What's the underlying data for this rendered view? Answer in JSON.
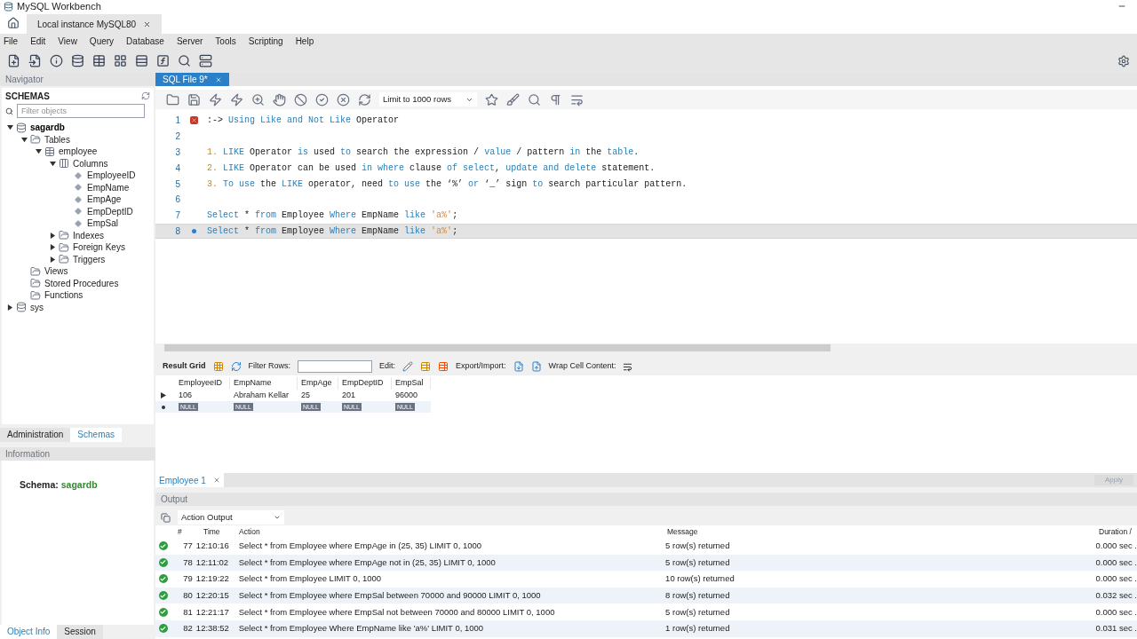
{
  "window": {
    "title": "MySQL Workbench"
  },
  "connection_tabs": [
    {
      "label": "Local instance MySQL80",
      "selected": true
    }
  ],
  "menu": [
    "File",
    "Edit",
    "View",
    "Query",
    "Database",
    "Server",
    "Tools",
    "Scripting",
    "Help"
  ],
  "navigator": {
    "title": "Navigator",
    "section": "SCHEMAS",
    "filter_placeholder": "Filter objects",
    "tree": [
      {
        "label": "sagardb",
        "kind": "database",
        "expanded": true,
        "selected": true,
        "children": [
          {
            "label": "Tables",
            "kind": "folder",
            "expanded": true,
            "selected": false,
            "children": [
              {
                "label": "employee",
                "kind": "table",
                "expanded": true,
                "selected": false,
                "children": [
                  {
                    "label": "Columns",
                    "kind": "columns",
                    "expanded": true,
                    "selected": false,
                    "children": [
                      {
                        "label": "EmployeeID",
                        "kind": "column",
                        "selected": false
                      },
                      {
                        "label": "EmpName",
                        "kind": "column",
                        "selected": false
                      },
                      {
                        "label": "EmpAge",
                        "kind": "column",
                        "selected": false
                      },
                      {
                        "label": "EmpDeptID",
                        "kind": "column",
                        "selected": false
                      },
                      {
                        "label": "EmpSal",
                        "kind": "column",
                        "selected": false
                      }
                    ]
                  },
                  {
                    "label": "Indexes",
                    "kind": "folder",
                    "expanded": false,
                    "selected": false
                  },
                  {
                    "label": "Foreign Keys",
                    "kind": "folder",
                    "expanded": false,
                    "selected": false
                  },
                  {
                    "label": "Triggers",
                    "kind": "folder",
                    "expanded": false,
                    "selected": false
                  }
                ]
              }
            ]
          },
          {
            "label": "Views",
            "kind": "folder",
            "selected": false
          },
          {
            "label": "Stored Procedures",
            "kind": "folder",
            "selected": false
          },
          {
            "label": "Functions",
            "kind": "folder",
            "selected": false
          }
        ]
      },
      {
        "label": "sys",
        "kind": "database",
        "expanded": false,
        "selected": false
      }
    ]
  },
  "side_tabs": [
    {
      "label": "Administration",
      "selected": false
    },
    {
      "label": "Schemas",
      "selected": true
    }
  ],
  "information": {
    "title": "Information",
    "label": "Schema:",
    "value": "sagardb"
  },
  "bottom_tabs": [
    {
      "label": "Object Info",
      "selected": true
    },
    {
      "label": "Session",
      "selected": false
    }
  ],
  "editor": {
    "tab": {
      "label": "SQL File 9*",
      "selected": true
    },
    "limit": "Limit to 1000 rows",
    "lines": [
      {
        "number": "1",
        "error": true,
        "statement": false,
        "current": false,
        "tokens": [
          {
            "text": ":-> ",
            "kind": "plain"
          },
          {
            "text": "Using Like and Not Like",
            "kind": "keyword"
          },
          {
            "text": " Operator",
            "kind": "plain"
          }
        ]
      },
      {
        "number": "2",
        "error": false,
        "statement": false,
        "current": false
      },
      {
        "number": "3",
        "error": false,
        "statement": false,
        "current": false,
        "tokens": [
          {
            "text": "1.",
            "kind": "number"
          },
          {
            "text": " LIKE",
            "kind": "keyword"
          },
          {
            "text": " Operator ",
            "kind": "plain"
          },
          {
            "text": "is",
            "kind": "keyword"
          },
          {
            "text": " used ",
            "kind": "plain"
          },
          {
            "text": "to",
            "kind": "keyword"
          },
          {
            "text": " search the expression / ",
            "kind": "plain"
          },
          {
            "text": "value",
            "kind": "keyword"
          },
          {
            "text": " / pattern ",
            "kind": "plain"
          },
          {
            "text": "in",
            "kind": "keyword"
          },
          {
            "text": " the ",
            "kind": "plain"
          },
          {
            "text": "table",
            "kind": "keyword"
          },
          {
            "text": ".",
            "kind": "plain"
          }
        ]
      },
      {
        "number": "4",
        "error": false,
        "statement": false,
        "current": false,
        "tokens": [
          {
            "text": "2.",
            "kind": "number"
          },
          {
            "text": " LIKE",
            "kind": "keyword"
          },
          {
            "text": " Operator can be used ",
            "kind": "plain"
          },
          {
            "text": "in where",
            "kind": "keyword"
          },
          {
            "text": " clause ",
            "kind": "plain"
          },
          {
            "text": "of select",
            "kind": "keyword"
          },
          {
            "text": ", ",
            "kind": "plain"
          },
          {
            "text": "update and delete",
            "kind": "keyword"
          },
          {
            "text": " statement.",
            "kind": "plain"
          }
        ]
      },
      {
        "number": "5",
        "error": false,
        "statement": false,
        "current": false,
        "tokens": [
          {
            "text": "3.",
            "kind": "number"
          },
          {
            "text": " To use",
            "kind": "keyword"
          },
          {
            "text": " the ",
            "kind": "plain"
          },
          {
            "text": "LIKE",
            "kind": "keyword"
          },
          {
            "text": " operator, need ",
            "kind": "plain"
          },
          {
            "text": "to use",
            "kind": "keyword"
          },
          {
            "text": " the ‘%’ ",
            "kind": "plain"
          },
          {
            "text": "or",
            "kind": "keyword"
          },
          {
            "text": " ‘_’ sign ",
            "kind": "plain"
          },
          {
            "text": "to",
            "kind": "keyword"
          },
          {
            "text": " search particular pattern.",
            "kind": "plain"
          }
        ]
      },
      {
        "number": "6",
        "error": false,
        "statement": false,
        "current": false
      },
      {
        "number": "7",
        "error": false,
        "statement": false,
        "current": false,
        "tokens": [
          {
            "text": "Select",
            "kind": "keyword"
          },
          {
            "text": " * ",
            "kind": "plain"
          },
          {
            "text": "from",
            "kind": "keyword"
          },
          {
            "text": " Employee ",
            "kind": "plain"
          },
          {
            "text": "Where",
            "kind": "keyword"
          },
          {
            "text": " EmpName ",
            "kind": "plain"
          },
          {
            "text": "like",
            "kind": "keyword"
          },
          {
            "text": " 'a%'",
            "kind": "string"
          },
          {
            "text": ";",
            "kind": "plain"
          }
        ]
      },
      {
        "number": "8",
        "error": false,
        "statement": true,
        "current": true,
        "tokens": [
          {
            "text": "Select",
            "kind": "keyword"
          },
          {
            "text": " * ",
            "kind": "plain"
          },
          {
            "text": "from",
            "kind": "keyword"
          },
          {
            "text": " Employee ",
            "kind": "plain"
          },
          {
            "text": "Where",
            "kind": "keyword"
          },
          {
            "text": " EmpName ",
            "kind": "plain"
          },
          {
            "text": "like",
            "kind": "keyword"
          },
          {
            "text": " 'a%'",
            "kind": "string"
          },
          {
            "text": ";",
            "kind": "plain"
          }
        ]
      }
    ]
  },
  "result": {
    "label": "Result Grid",
    "filter_label": "Filter Rows:",
    "edit_label": "Edit:",
    "export_label": "Export/Import:",
    "wrap_label": "Wrap Cell Content:",
    "columns": [
      "EmployeeID",
      "EmpName",
      "EmpAge",
      "EmpDeptID",
      "EmpSal"
    ],
    "rows": [
      {
        "kind": "data",
        "cells": [
          "106",
          "Abraham Kellar",
          "25",
          "201",
          "96000"
        ]
      },
      {
        "kind": "new",
        "cells": [
          "NULL",
          "NULL",
          "NULL",
          "NULL",
          "NULL"
        ]
      }
    ]
  },
  "result_tabs": [
    {
      "label": "Employee 1",
      "selected": true
    }
  ],
  "apply_button": {
    "label": "Apply",
    "disabled": true
  },
  "output": {
    "title": "Output",
    "selector": "Action Output",
    "columns": [
      "#",
      "Time",
      "Action",
      "Message",
      "Duration /"
    ],
    "rows": [
      {
        "success": true,
        "number": "77",
        "time": "12:10:16",
        "action": "Select * from Employee where EmpAge in (25, 35) LIMIT 0, 1000",
        "message": "5 row(s) returned",
        "duration": "0.000 sec ."
      },
      {
        "success": true,
        "number": "78",
        "time": "12:11:02",
        "action": "Select * from Employee where EmpAge not in (25, 35) LIMIT 0, 1000",
        "message": "5 row(s) returned",
        "duration": "0.000 sec ."
      },
      {
        "success": true,
        "number": "79",
        "time": "12:19:22",
        "action": "Select * from Employee LIMIT 0, 1000",
        "message": "10 row(s) returned",
        "duration": "0.000 sec ."
      },
      {
        "success": true,
        "number": "80",
        "time": "12:20:15",
        "action": "Select * from Employee where EmpSal between 70000 and 90000 LIMIT 0, 1000",
        "message": "8 row(s) returned",
        "duration": "0.032 sec ."
      },
      {
        "success": true,
        "number": "81",
        "time": "12:21:17",
        "action": "Select * from Employee where EmpSal not between 70000 and 80000 LIMIT 0, 1000",
        "message": "5 row(s) returned",
        "duration": "0.000 sec ."
      },
      {
        "success": true,
        "number": "82",
        "time": "12:38:52",
        "action": "Select * from Employee Where EmpName like 'a%' LIMIT 0, 1000",
        "message": "1 row(s) returned",
        "duration": "0.031 sec ."
      }
    ]
  }
}
